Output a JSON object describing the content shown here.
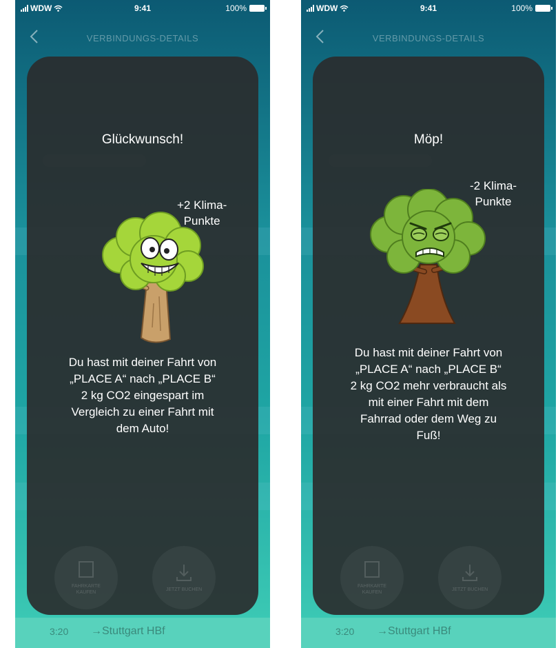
{
  "screens": [
    {
      "status": {
        "carrier": "WDW",
        "time": "9:41",
        "battery": "100%"
      },
      "nav": {
        "title": "VERBINDUNGS-DETAILS"
      },
      "background": {
        "time": "3:20",
        "destination": "→Stuttgart HBf"
      },
      "modal": {
        "title": "Glückwunsch!",
        "points_line1": "+2 Klima-",
        "points_line2": "Punkte",
        "message_lines": [
          "Du hast mit deiner Fahrt von",
          "„PLACE A“ nach „PLACE B“",
          "2 kg CO2 eingespart im",
          "Vergleich zu einer Fahrt mit",
          "dem Auto!"
        ],
        "tree_mood": "happy",
        "actions": [
          "FAHRKARTE KAUFEN",
          "JETZT BUCHEN"
        ]
      },
      "icons": [
        "signal-icon",
        "wifi-icon",
        "battery-icon",
        "back-chevron-icon",
        "happy-tree-icon"
      ]
    },
    {
      "status": {
        "carrier": "WDW",
        "time": "9:41",
        "battery": "100%"
      },
      "nav": {
        "title": "VERBINDUNGS-DETAILS"
      },
      "background": {
        "time": "3:20",
        "destination": "→Stuttgart HBf"
      },
      "modal": {
        "title": "Möp!",
        "points_line1": "-2 Klima-",
        "points_line2": "Punkte",
        "message_lines": [
          "Du hast mit deiner Fahrt von",
          "„PLACE A“ nach „PLACE B“",
          "2 kg CO2 mehr verbraucht als",
          "mit einer Fahrt mit dem",
          "Fahrrad oder dem Weg zu",
          "Fuß!"
        ],
        "tree_mood": "angry",
        "actions": [
          "FAHRKARTE KAUFEN",
          "JETZT BUCHEN"
        ]
      },
      "icons": [
        "signal-icon",
        "wifi-icon",
        "battery-icon",
        "back-chevron-icon",
        "angry-tree-icon"
      ]
    }
  ]
}
